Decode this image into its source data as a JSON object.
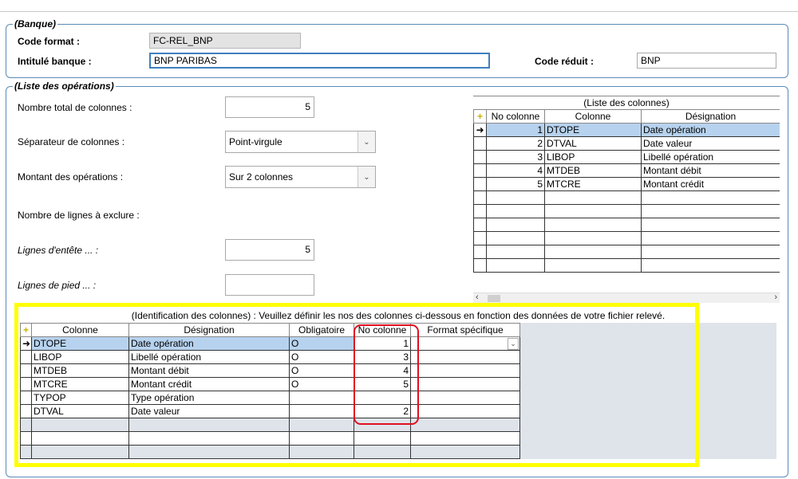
{
  "banque": {
    "legend": "(Banque)",
    "code_format_label": "Code format :",
    "code_format_value": "FC-REL_BNP",
    "intitule_label": "Intitulé banque :",
    "intitule_value": "BNP PARIBAS",
    "code_reduit_label": "Code réduit :",
    "code_reduit_value": "BNP"
  },
  "operations": {
    "legend": "(Liste des opérations)",
    "nb_colonnes_label": "Nombre total de colonnes :",
    "nb_colonnes_value": "5",
    "separateur_label": "Séparateur de colonnes :",
    "separateur_value": "Point-virgule",
    "montant_label": "Montant des opérations :",
    "montant_value": "Sur 2 colonnes",
    "nb_lignes_label": "Nombre de lignes à exclure :",
    "entete_label": "Lignes d'entête ... :",
    "entete_value": "5",
    "pied_label": "Lignes de pied ... :",
    "pied_value": ""
  },
  "liste_colonnes": {
    "title": "(Liste des colonnes)",
    "headers": [
      "No colonne",
      "Colonne",
      "Désignation"
    ],
    "rows": [
      {
        "no": "1",
        "colonne": "DTOPE",
        "designation": "Date opération"
      },
      {
        "no": "2",
        "colonne": "DTVAL",
        "designation": "Date valeur"
      },
      {
        "no": "3",
        "colonne": "LIBOP",
        "designation": "Libellé opération"
      },
      {
        "no": "4",
        "colonne": "MTDEB",
        "designation": "Montant débit"
      },
      {
        "no": "5",
        "colonne": "MTCRE",
        "designation": "Montant crédit"
      }
    ]
  },
  "identification": {
    "title": "(Identification des colonnes) : Veuillez définir les nos des colonnes ci-dessous en fonction des données de votre fichier relevé.",
    "headers": [
      "Colonne",
      "Désignation",
      "Obligatoire",
      "No colonne",
      "Format spécifique"
    ],
    "rows": [
      {
        "colonne": "DTOPE",
        "designation": "Date opération",
        "obligatoire": "O",
        "no": "1",
        "format": ""
      },
      {
        "colonne": "LIBOP",
        "designation": "Libellé opération",
        "obligatoire": "O",
        "no": "3",
        "format": ""
      },
      {
        "colonne": "MTDEB",
        "designation": "Montant débit",
        "obligatoire": "O",
        "no": "4",
        "format": ""
      },
      {
        "colonne": "MTCRE",
        "designation": "Montant crédit",
        "obligatoire": "O",
        "no": "5",
        "format": ""
      },
      {
        "colonne": "TYPOP",
        "designation": "Type opération",
        "obligatoire": "",
        "no": "",
        "format": ""
      },
      {
        "colonne": "DTVAL",
        "designation": "Date valeur",
        "obligatoire": "",
        "no": "2",
        "format": ""
      }
    ]
  },
  "colors": {
    "highlight_yellow": "#ffff00",
    "highlight_red": "#e01020",
    "selected_row": "#b7d2ee",
    "group_border": "#5a8bb5"
  }
}
